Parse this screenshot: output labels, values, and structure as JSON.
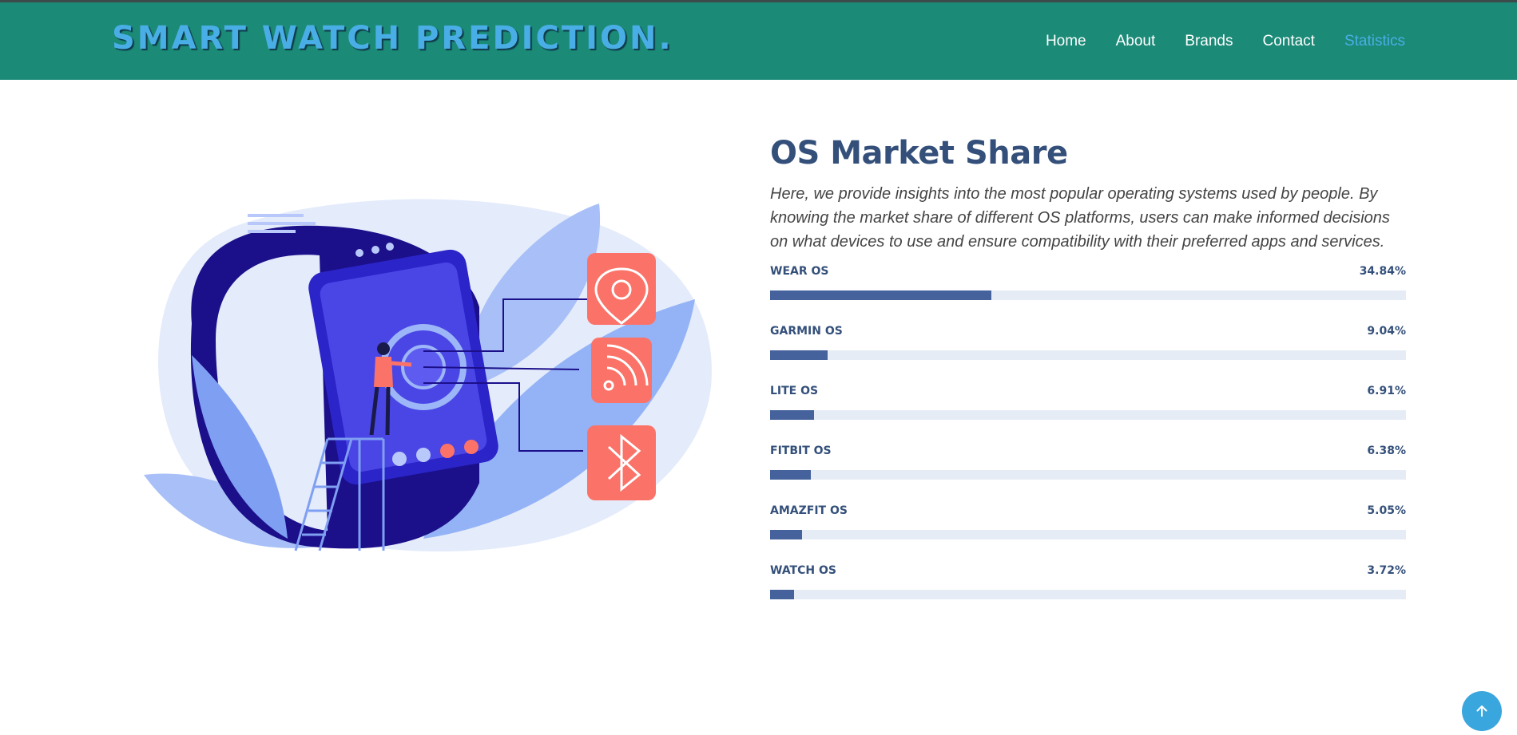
{
  "header": {
    "logo": "SMART WATCH PREDICTION.",
    "nav": [
      {
        "label": "Home",
        "active": false
      },
      {
        "label": "About",
        "active": false
      },
      {
        "label": "Brands",
        "active": false
      },
      {
        "label": "Contact",
        "active": false
      },
      {
        "label": "Statistics",
        "active": true
      }
    ]
  },
  "main": {
    "title": "OS Market Share",
    "description": "Here, we provide insights into the most popular operating systems used by people. By knowing the market share of different OS platforms, users can make informed decisions on what devices to use and ensure compatibility with their preferred apps and services.",
    "bars": [
      {
        "label": "WEAR OS",
        "value_text": "34.84%",
        "value": 34.84
      },
      {
        "label": "GARMIN OS",
        "value_text": "9.04%",
        "value": 9.04
      },
      {
        "label": "LITE OS",
        "value_text": "6.91%",
        "value": 6.91
      },
      {
        "label": "FITBIT OS",
        "value_text": "6.38%",
        "value": 6.38
      },
      {
        "label": "AMAZFIT OS",
        "value_text": "5.05%",
        "value": 5.05
      },
      {
        "label": "WATCH OS",
        "value_text": "3.72%",
        "value": 3.72
      }
    ]
  },
  "icons": {
    "back_to_top": "arrow-up-icon",
    "illustration": [
      "location-pin-icon",
      "rss-feed-icon",
      "bluetooth-icon"
    ]
  },
  "colors": {
    "header_bg": "#1b8a77",
    "logo": "#4aaee6",
    "active_nav": "#4aaee6",
    "title": "#34507a",
    "bar_fill": "#45629c",
    "bar_track": "#e6ecf6",
    "back_to_top": "#3aa6de",
    "icon_tile": "#fb7268"
  }
}
